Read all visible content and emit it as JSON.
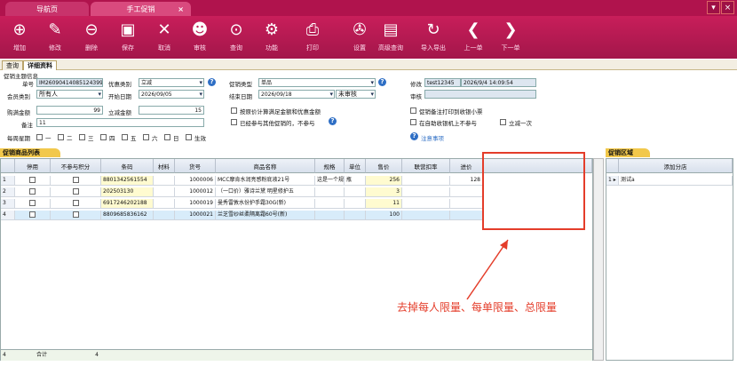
{
  "tabs": {
    "home": "导航页",
    "promo": "手工促销",
    "close": "×"
  },
  "window": {
    "min": "▾",
    "close": "×"
  },
  "toolbar": [
    "增加",
    "修改",
    "删除",
    "保存",
    "取消",
    "审核",
    "查询",
    "功能",
    "打印",
    "设置",
    "高级查询",
    "导入导出",
    "上一单",
    "下一单"
  ],
  "toolbar_icons": [
    "plus-icon",
    "pencil-icon",
    "minus-icon",
    "save-icon",
    "close-icon",
    "person-icon",
    "zoom-icon",
    "gear-icon",
    "printer-icon",
    "wrench-icon",
    "advanced-search-icon",
    "refresh-icon",
    "prev-icon",
    "next-icon"
  ],
  "subtabs": [
    "查询",
    "详细资料"
  ],
  "form": {
    "section": "促销主题信息",
    "order_no_label": "单号",
    "order_no": "IM26090414085124399",
    "discount_type_label": "优惠类别",
    "discount_type": "立减",
    "promo_type_label": "促销类型",
    "promo_type": "单品",
    "modify_label": "修改",
    "modify_user": "test12345",
    "modify_time": "2026/9/4 14:09:54",
    "member_type_label": "会员类别",
    "member_type": "所有人",
    "start_label": "开始日期",
    "start_date": "2026/09/05",
    "end_label": "结束日期",
    "end_date": "2026/09/18",
    "audit_status": "未审核",
    "audit_label": "审核",
    "buy_amount_label": "购满金额",
    "buy_amount": "99",
    "reduce_label": "立减金额",
    "reduce_amount": "15",
    "check1": "按原价计算满足金额和优惠金额",
    "check2": "已经参与其他促销的，不参与",
    "check3": "促销备注打印到收银小票",
    "check4": "在自助收银机上不参与",
    "check5": "立减一次",
    "note_label": "备注",
    "note_value": "11",
    "weekday_label": "每周星期",
    "weekdays": [
      "一",
      "二",
      "三",
      "四",
      "五",
      "六",
      "日"
    ],
    "effective": "生效",
    "attention": "注意事项"
  },
  "left_panel_title": "促销商品列表",
  "columns": [
    "停用",
    "不参与积分",
    "条码",
    "材料",
    "货号",
    "商品名称",
    "规格",
    "单位",
    "售价",
    "联营扣率",
    "进价"
  ],
  "rows": [
    {
      "n": "1",
      "barcode": "8801342561554",
      "sku": "1000006",
      "name": "MCC摩肯水润亮感粉底液21号",
      "spec": "这是一个规",
      "unit": "瓶",
      "price": "256",
      "cost": "128"
    },
    {
      "n": "2",
      "barcode": "202503130",
      "sku": "1000012",
      "name": "（一口价）雅诗兰黛 明星修护五",
      "spec": "",
      "unit": "",
      "price": "3",
      "cost": ""
    },
    {
      "n": "3",
      "barcode": "6917246202188",
      "sku": "1000019",
      "name": "曼秀雷敦水份护手霜30G(新)",
      "spec": "",
      "unit": "",
      "price": "11",
      "cost": ""
    },
    {
      "n": "4",
      "barcode": "8809685836162",
      "sku": "1000021",
      "name": "兰芝雪纱丝柔隔离霜60号(新)",
      "spec": "",
      "unit": "",
      "price": "100",
      "cost": ""
    }
  ],
  "footer": {
    "count_row": "4",
    "total_label": "合计",
    "total_count": "4"
  },
  "right_panel_title": "促销区域",
  "right_header": "添加分店",
  "right_rows": [
    {
      "n": "1",
      "marker": "▸",
      "name": "测试a"
    }
  ],
  "annotation": "去掉每人限量、每单限量、总限量"
}
